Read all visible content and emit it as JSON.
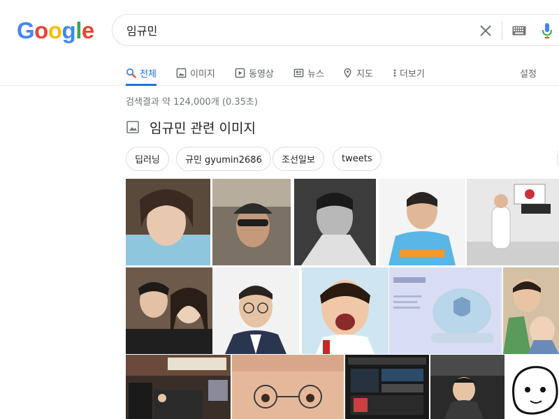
{
  "header": {
    "logo": {
      "letters": [
        {
          "char": "G",
          "color": "#4285F4"
        },
        {
          "char": "o",
          "color": "#EA4335"
        },
        {
          "char": "o",
          "color": "#FBBC05"
        },
        {
          "char": "g",
          "color": "#4285F4"
        },
        {
          "char": "l",
          "color": "#34A853"
        },
        {
          "char": "e",
          "color": "#EA4335"
        }
      ]
    },
    "search": {
      "value": "임규민"
    },
    "icons": {
      "clear": "close-icon",
      "keyboard": "keyboard-icon",
      "mic": "microphone-icon"
    }
  },
  "tabs": {
    "items": [
      {
        "label": "전체",
        "icon": "search-icon",
        "active": true
      },
      {
        "label": "이미지",
        "icon": "image-icon",
        "active": false
      },
      {
        "label": "동영상",
        "icon": "video-icon",
        "active": false
      },
      {
        "label": "뉴스",
        "icon": "news-icon",
        "active": false
      },
      {
        "label": "지도",
        "icon": "map-pin-icon",
        "active": false
      },
      {
        "label": "더보기",
        "icon": "more-vertical-icon",
        "active": false
      }
    ],
    "settings_label": "설정"
  },
  "results": {
    "stats": "검색결과 약 124,000개 (0.35초)",
    "image_section_title": "임규민 관련 이미지",
    "chips": [
      "딥러닝",
      "규민 gyumin2686",
      "조선일보",
      "tweets"
    ]
  },
  "colors": {
    "accent": "#1a73e8",
    "text_secondary": "#5f6368",
    "border": "#dadce0"
  }
}
